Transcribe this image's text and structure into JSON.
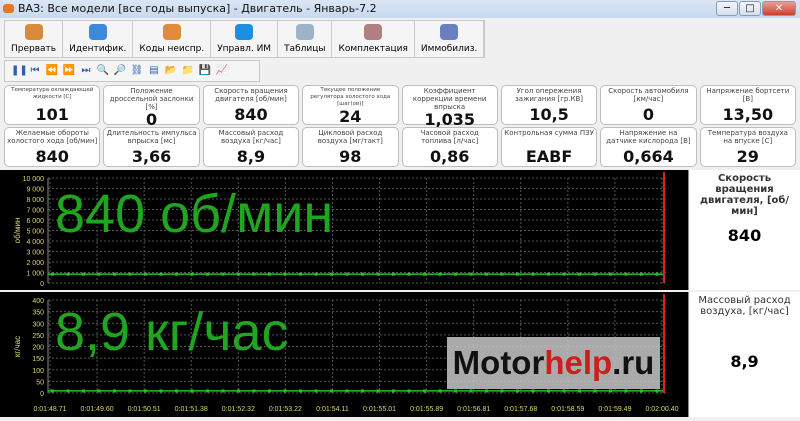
{
  "window": {
    "title": "ВАЗ: Все модели [все годы выпуска] - Двигатель - Январь-7.2",
    "minimize": "─",
    "maximize": "□",
    "close": "✕"
  },
  "toolbar": [
    {
      "label": "Прервать",
      "icon": "abort-icon",
      "color": "#d98a3a"
    },
    {
      "label": "Идентифик.",
      "icon": "info-icon",
      "color": "#3a8ad9"
    },
    {
      "label": "Коды неиспр.",
      "icon": "engine-error-icon",
      "color": "#e08a3a"
    },
    {
      "label": "Управл. ИМ",
      "icon": "gear-icon",
      "color": "#1e8ee0"
    },
    {
      "label": "Таблицы",
      "icon": "table-icon",
      "color": "#9fb3c8"
    },
    {
      "label": "Комплектация",
      "icon": "config-icon",
      "color": "#b08080"
    },
    {
      "label": "Иммобилиз.",
      "icon": "immobilizer-icon",
      "color": "#6a7fc0"
    }
  ],
  "playback": [
    {
      "icon": "pause-icon",
      "glyph": "❚❚"
    },
    {
      "icon": "first-icon",
      "glyph": "⏮"
    },
    {
      "icon": "rewind-icon",
      "glyph": "⏪"
    },
    {
      "icon": "forward-icon",
      "glyph": "⏩"
    },
    {
      "icon": "last-icon",
      "glyph": "⏭"
    },
    {
      "icon": "zoom-out-icon",
      "glyph": "🔍"
    },
    {
      "icon": "zoom-in-icon",
      "glyph": "🔎"
    },
    {
      "icon": "link-icon",
      "glyph": "⛓"
    },
    {
      "icon": "import-icon",
      "glyph": "▤"
    },
    {
      "icon": "open-icon",
      "glyph": "📂"
    },
    {
      "icon": "open-folder-icon",
      "glyph": "📁"
    },
    {
      "icon": "save-icon",
      "glyph": "💾"
    },
    {
      "icon": "chart-icon",
      "glyph": "📈"
    }
  ],
  "gauges": [
    {
      "label": "Температура охлаждающей жидкости [C]",
      "value": "101",
      "tiny": true
    },
    {
      "label": "Положение дроссельной заслонки [%]",
      "value": "0"
    },
    {
      "label": "Скорость вращения двигателя [об/мин]",
      "value": "840"
    },
    {
      "label": "Текущее положение регулятора холостого хода [шаг(ов)]",
      "value": "24",
      "tiny": true
    },
    {
      "label": "Коэффициент коррекции времени впрыска",
      "value": "1,035"
    },
    {
      "label": "Угол опережения зажигания [гр.КВ]",
      "value": "10,5"
    },
    {
      "label": "Скорость автомобиля [км/час]",
      "value": "0"
    },
    {
      "label": "Напряжение бортсети [В]",
      "value": "13,50"
    },
    {
      "label": "Желаемые обороты холостого хода [об/мин]",
      "value": "840"
    },
    {
      "label": "Длительность импульса впрыска [мс]",
      "value": "3,66"
    },
    {
      "label": "Массовый расход воздуха [кг/час]",
      "value": "8,9"
    },
    {
      "label": "Цикловой расход воздуха [мг/такт]",
      "value": "98"
    },
    {
      "label": "Часовой расход топлива [л/час]",
      "value": "0,86"
    },
    {
      "label": "Контрольная сумма ПЗУ",
      "value": "EABF"
    },
    {
      "label": "Напряжение на датчике кислорода [В]",
      "value": "0,664"
    },
    {
      "label": "Температура воздуха на впуске [C]",
      "value": "29"
    }
  ],
  "charts": [
    {
      "ylabel": "об/мин",
      "overlay": "840 об/мин",
      "ylim": [
        0,
        10000
      ],
      "ticks": [
        "0",
        "1 000",
        "2 000",
        "3 000",
        "4 000",
        "5 000",
        "6 000",
        "7 000",
        "8 000",
        "9 000",
        "10 000"
      ],
      "value": 840,
      "side_label": "Скорость вращения двигателя, [об/мин]",
      "side_value": "840"
    },
    {
      "ylabel": "кг/час",
      "overlay": "8,9 кг/час",
      "ylim": [
        0,
        400
      ],
      "ticks": [
        "0",
        "50",
        "100",
        "150",
        "200",
        "250",
        "300",
        "350",
        "400"
      ],
      "value": 8.9,
      "side_label": "Массовый расход воздуха, [кг/час]",
      "side_value": "8,9"
    }
  ],
  "time_ticks": [
    "0:01:48.71",
    "0:01:49.60",
    "0:01:50.51",
    "0:01:51.38",
    "0:01:52.32",
    "0:01:53.22",
    "0:01:54.11",
    "0:01:55.01",
    "0:01:55.89",
    "0:01:56.81",
    "0:01:57.68",
    "0:01:58.59",
    "0:01:59.49",
    "0:02:00.40"
  ],
  "watermark": {
    "part1": "Motor",
    "part2": "help",
    "part3": ".ru"
  },
  "colors": {
    "series": "#22c422",
    "overlay": "#1fa51f",
    "tick": "#d8d870",
    "cursor": "#e02020"
  }
}
